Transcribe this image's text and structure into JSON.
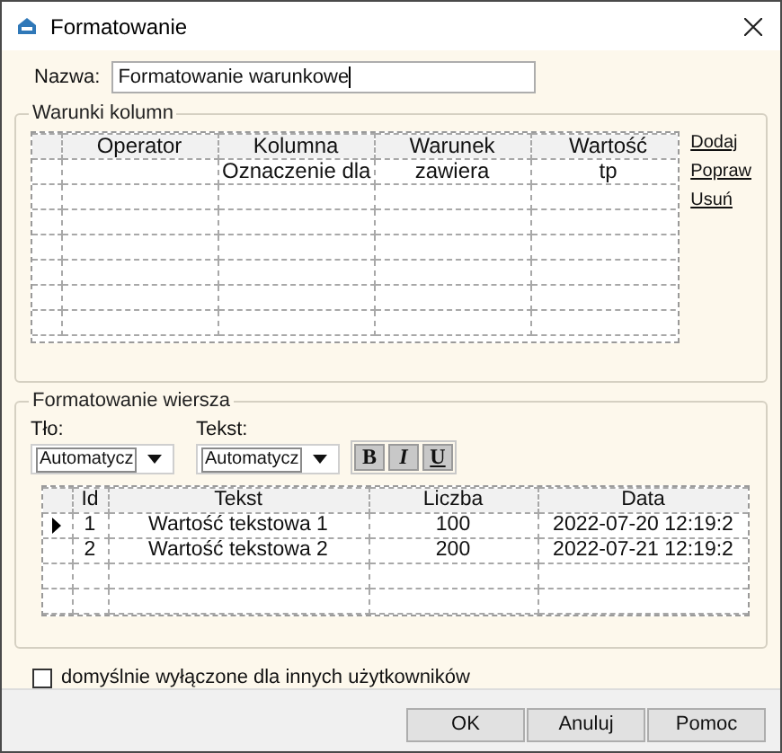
{
  "window": {
    "title": "Formatowanie"
  },
  "name_field": {
    "label": "Nazwa:",
    "value": "Formatowanie warunkowe"
  },
  "conditions": {
    "title": "Warunki kolumn",
    "columns": [
      "Operator",
      "Kolumna",
      "Warunek",
      "Wartość"
    ],
    "rows": [
      {
        "column": "Oznaczenie dla",
        "condition": "zawiera",
        "value": "tp"
      }
    ],
    "links": [
      "Dodaj",
      "Popraw",
      "Usuń"
    ]
  },
  "row_format": {
    "title": "Formatowanie wiersza",
    "background": {
      "label": "Tło:",
      "value": "Automatycz"
    },
    "text": {
      "label": "Tekst:",
      "value": "Automatycz"
    },
    "style_buttons": [
      {
        "label": "B",
        "kind": "bold"
      },
      {
        "label": "I",
        "kind": "italic"
      },
      {
        "label": "U",
        "kind": "underline"
      }
    ],
    "preview": {
      "columns": [
        "Id",
        "Tekst",
        "Liczba",
        "Data"
      ],
      "rows": [
        {
          "current": true,
          "cells": [
            "1",
            "Wartość tekstowa 1",
            "100",
            "2022-07-20 12:19:2"
          ]
        },
        {
          "current": false,
          "cells": [
            "2",
            "Wartość tekstowa 2",
            "200",
            "2022-07-21 12:19:2"
          ]
        }
      ]
    }
  },
  "checkbox": {
    "label": "domyślnie wyłączone dla innych użytkowników",
    "checked": false
  },
  "buttons": [
    "OK",
    "Anuluj",
    "Pomoc"
  ]
}
